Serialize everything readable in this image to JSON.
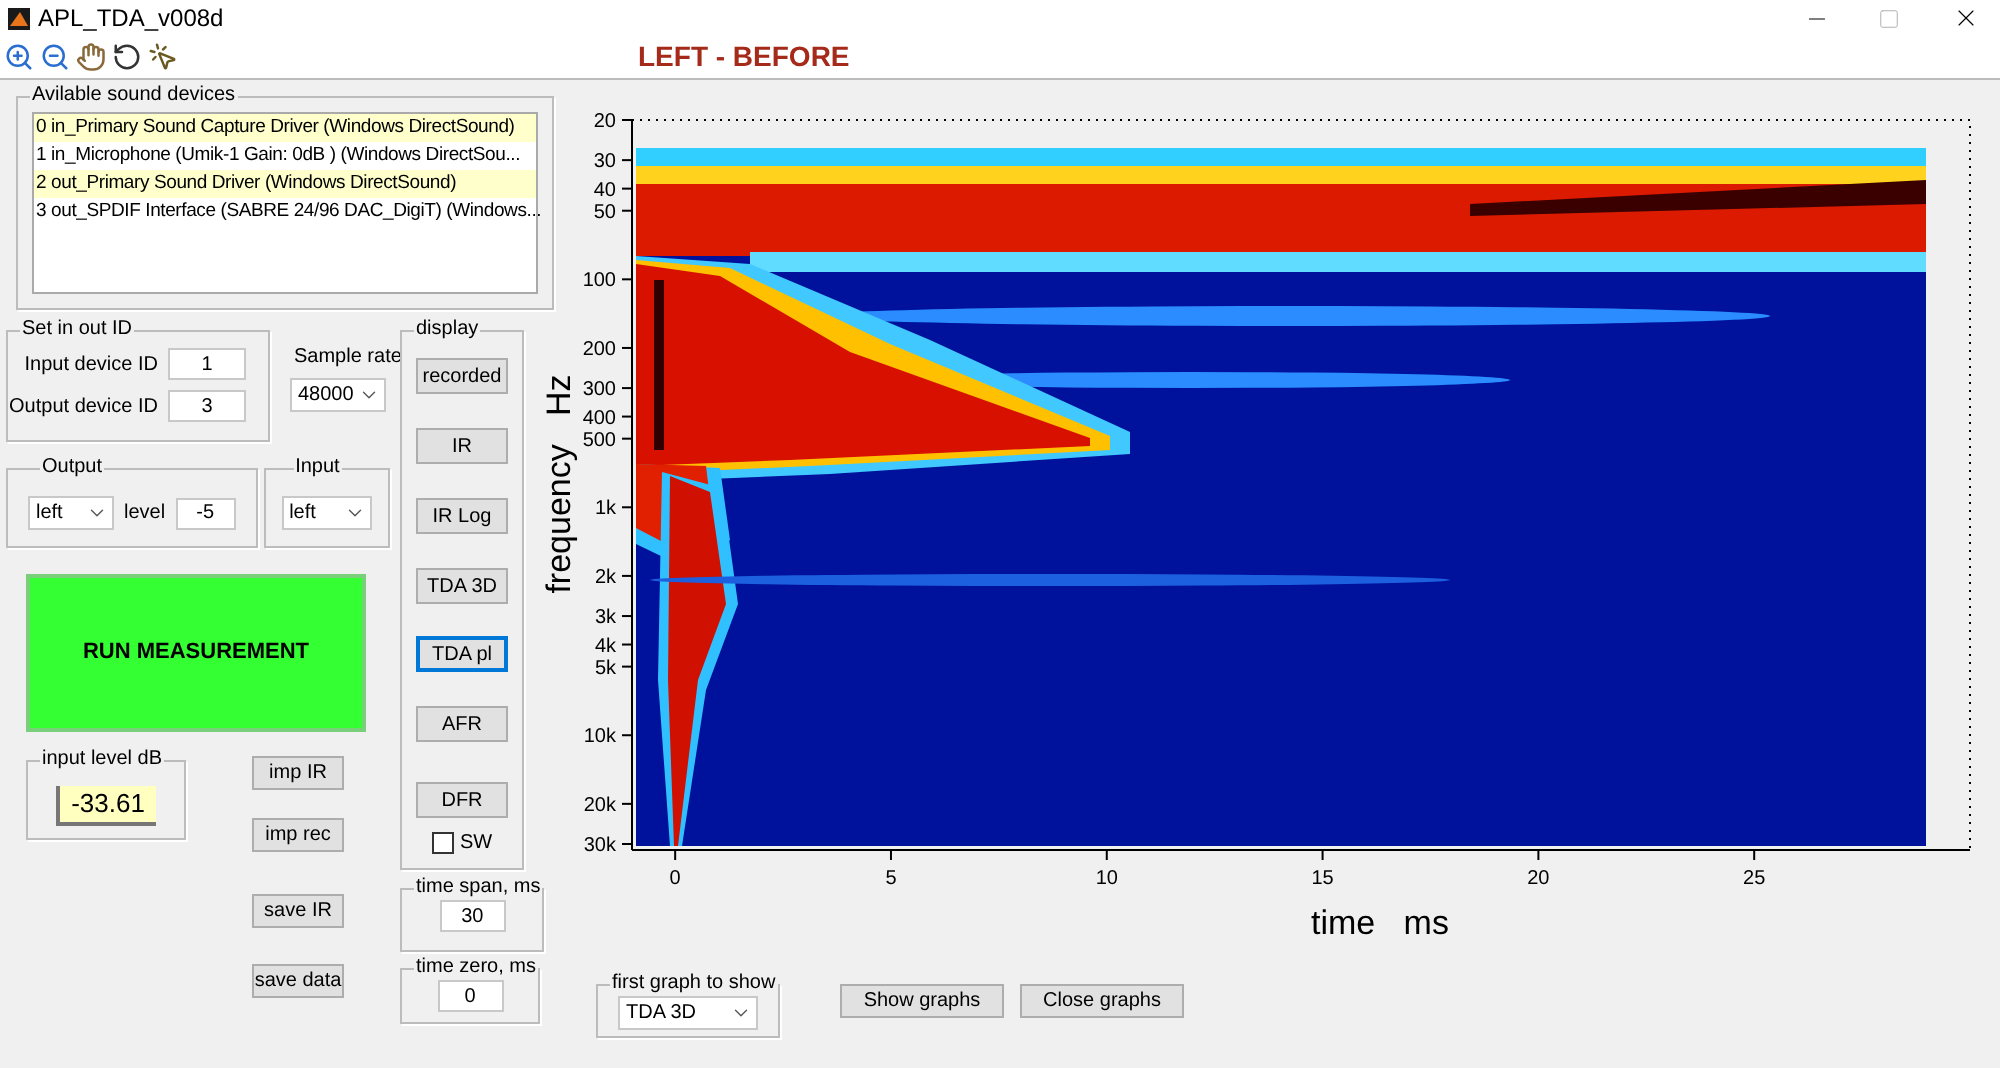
{
  "window": {
    "title": "APL_TDA_v008d"
  },
  "heading": "LEFT - BEFORE",
  "devices": {
    "title": "Avilable sound devices",
    "items": [
      {
        "label": "0 in_Primary Sound Capture Driver (Windows DirectSound)",
        "selected": true
      },
      {
        "label": "1 in_Microphone (Umik-1  Gain:  0dB  ) (Windows DirectSou...",
        "selected": false
      },
      {
        "label": "2 out_Primary Sound Driver (Windows DirectSound)",
        "selected": true
      },
      {
        "label": "3 out_SPDIF Interface (SABRE 24/96 DAC_DigiT) (Windows...",
        "selected": false
      }
    ]
  },
  "set_ids": {
    "title": "Set in out ID",
    "fields": [
      {
        "label": "Input device ID",
        "value": "1"
      },
      {
        "label": "Output device ID",
        "value": "3"
      }
    ]
  },
  "sample_rate": {
    "label": "Sample rate",
    "value": "48000"
  },
  "output": {
    "title": "Output",
    "channel": "left",
    "gain_label": "level",
    "gain_value": "-5"
  },
  "input": {
    "title": "Input",
    "channel": "left"
  },
  "run_button": "RUN MEASUREMENT",
  "input_level": {
    "title": "input level dB",
    "value": "-33.61"
  },
  "file_buttons": [
    "imp IR",
    "imp rec",
    "save IR",
    "save data"
  ],
  "display": {
    "title": "display",
    "buttons": [
      {
        "label": "recorded",
        "selected": false
      },
      {
        "label": "IR",
        "selected": false
      },
      {
        "label": "IR Log",
        "selected": false
      },
      {
        "label": "TDA 3D",
        "selected": false
      },
      {
        "label": "TDA pl",
        "selected": true
      },
      {
        "label": "AFR",
        "selected": false
      },
      {
        "label": "DFR",
        "selected": false
      }
    ],
    "sw": {
      "label": "SW",
      "checked": false
    }
  },
  "time_span": {
    "title": "time span, ms",
    "value": "30"
  },
  "time_zero": {
    "title": "time zero, ms",
    "value": "0"
  },
  "plot": {
    "ylabel": "frequency   Hz",
    "xlabel": "time   ms",
    "xticks": [
      "0",
      "5",
      "10",
      "15",
      "20",
      "25"
    ],
    "yticks": [
      "20",
      "30",
      "40",
      "50",
      "100",
      "200",
      "300",
      "400",
      "500",
      "1k",
      "2k",
      "3k",
      "4k",
      "5k",
      "10k",
      "20k",
      "30k"
    ]
  },
  "first_graph": {
    "title": "first graph to show",
    "value": "TDA 3D"
  },
  "graph_buttons": [
    "Show graphs",
    "Close graphs"
  ]
}
